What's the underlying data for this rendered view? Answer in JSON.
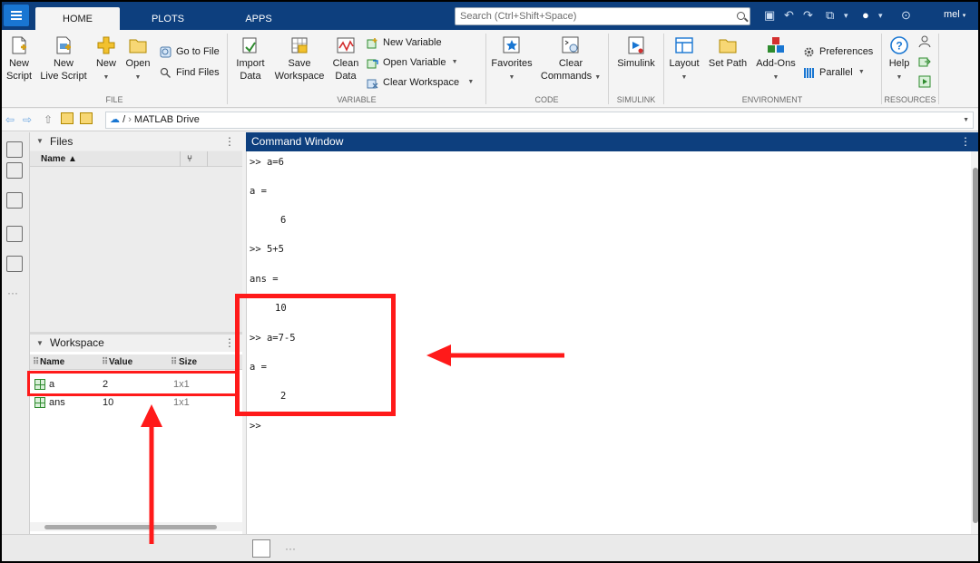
{
  "topbar": {
    "tabs": [
      "HOME",
      "PLOTS",
      "APPS"
    ],
    "search_placeholder": "Search (Ctrl+Shift+Space)",
    "user": "mel"
  },
  "ribbon": {
    "file": {
      "new_script": "New\nScript",
      "new_live_script": "New\nLive Script",
      "new": "New",
      "open": "Open",
      "go_to_file": "Go to File",
      "find_files": "Find Files",
      "label": "FILE"
    },
    "variable": {
      "import_data": "Import\nData",
      "save_workspace": "Save\nWorkspace",
      "clean_data": "Clean\nData",
      "new_variable": "New Variable",
      "open_variable": "Open Variable",
      "clear_workspace": "Clear Workspace",
      "label": "VARIABLE"
    },
    "code": {
      "favorites": "Favorites",
      "clear_commands": "Clear\nCommands",
      "label": "CODE"
    },
    "simulink": {
      "simulink": "Simulink",
      "label": "SIMULINK"
    },
    "environment": {
      "layout": "Layout",
      "set_path": "Set Path",
      "add_ons": "Add-Ons",
      "preferences": "Preferences",
      "parallel": "Parallel",
      "label": "ENVIRONMENT"
    },
    "resources": {
      "help": "Help",
      "label": "RESOURCES"
    }
  },
  "address": {
    "slash": "/",
    "current": "MATLAB Drive"
  },
  "files": {
    "title": "Files",
    "col_name": "Name ▲"
  },
  "workspace": {
    "title": "Workspace",
    "columns": [
      "Name",
      "Value",
      "Size"
    ],
    "rows": [
      {
        "name": "a",
        "value": "2",
        "size": "1x1"
      },
      {
        "name": "ans",
        "value": "10",
        "size": "1x1"
      }
    ]
  },
  "command_window": {
    "title": "Command Window",
    "lines": [
      ">> a=6",
      "a =",
      "6",
      ">> 5+5",
      "ans =",
      "10",
      ">> a=7-5",
      "a =",
      "2",
      ">>"
    ]
  },
  "colors": {
    "topbar": "#0d3f7e",
    "accent": "#1976d2",
    "annotation": "#ff1a1a"
  }
}
